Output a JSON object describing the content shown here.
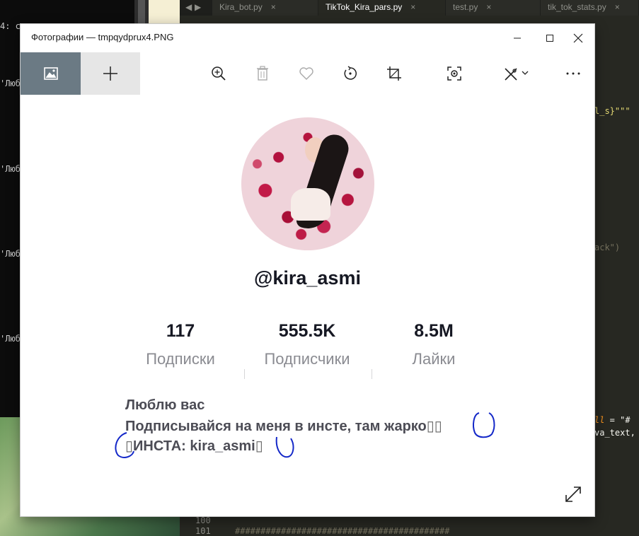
{
  "terminal": {
    "lines": [
      "4: с",
      "'Люб",
      "'Люб",
      "'Люб",
      "'Люб"
    ]
  },
  "editor": {
    "nav_arrows": "◀ ▶",
    "tabs": [
      {
        "label": "Kira_bot.py",
        "close": "×"
      },
      {
        "label": "TikTok_Kira_pars.py",
        "close": "×"
      },
      {
        "label": "test.py",
        "close": "×"
      },
      {
        "label": "tik_tok_stats.py",
        "close": "×"
      }
    ],
    "line_numbers": [
      "100",
      "101"
    ],
    "code_fragments": {
      "frag1": "l_s}\"\"\"",
      "frag2": "ack\")",
      "frag3_a": "ll",
      "frag3_b": " = \"#",
      "frag4": "va_text,",
      "frag5": "##########################################"
    }
  },
  "window": {
    "title": "Фотографии — tmpqydprux4.PNG",
    "controls": {
      "minimize": "minimize",
      "maximize": "maximize",
      "close": "close"
    },
    "toolbar": {
      "left": [
        "gallery-icon",
        "add-icon"
      ],
      "tools": [
        "zoom-in-icon",
        "delete-icon",
        "favorite-icon",
        "rotate-icon",
        "crop-icon",
        "enhance-icon",
        "edit-draw-icon",
        "more-icon"
      ]
    }
  },
  "profile": {
    "username": "@kira_asmi",
    "stats": [
      {
        "value": "117",
        "label": "Подписки"
      },
      {
        "value": "555.5K",
        "label": "Подписчики"
      },
      {
        "value": "8.5M",
        "label": "Лайки"
      }
    ],
    "bio": {
      "line1": "Люблю вас",
      "line2": "Подписывайся на меня в инсте, там жарко",
      "line2_glyphs": "▯▯",
      "line3_glyph_start": "▯",
      "line3": "ИНСТА: kira_asmi",
      "line3_glyph_end": "▯"
    }
  },
  "colors": {
    "annotation": "#1428c8",
    "text_primary": "#161823",
    "text_secondary": "#8a8b91",
    "toolbar_active": "#6b7a84"
  }
}
